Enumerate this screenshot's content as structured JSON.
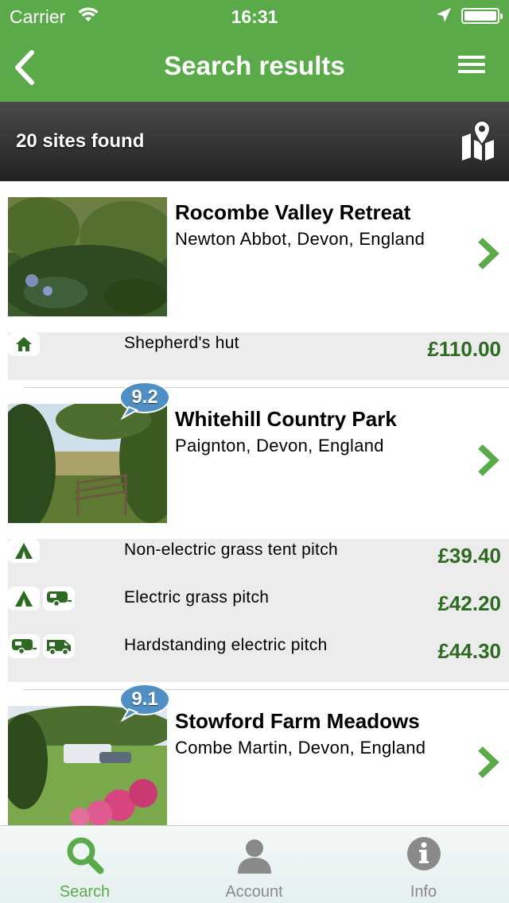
{
  "status_bar": {
    "carrier": "Carrier",
    "time": "16:31"
  },
  "nav": {
    "title": "Search results"
  },
  "results": {
    "count_text": "20 sites found"
  },
  "sites": [
    {
      "name": "Rocombe Valley Retreat",
      "location": "Newton Abbot, Devon, England",
      "rating": null,
      "pitches": [
        {
          "label": "Shepherd's hut",
          "price": "£110.00",
          "icons": [
            "house-icon"
          ]
        }
      ]
    },
    {
      "name": "Whitehill Country Park",
      "location": "Paignton, Devon, England",
      "rating": "9.2",
      "pitches": [
        {
          "label": "Non-electric grass tent pitch",
          "price": "£39.40",
          "icons": [
            "tent-icon"
          ]
        },
        {
          "label": "Electric grass pitch",
          "price": "£42.20",
          "icons": [
            "tent-icon",
            "caravan-icon"
          ]
        },
        {
          "label": "Hardstanding electric pitch",
          "price": "£44.30",
          "icons": [
            "caravan-icon",
            "motorhome-icon"
          ]
        }
      ]
    },
    {
      "name": "Stowford Farm Meadows",
      "location": "Combe Martin, Devon, England",
      "rating": "9.1",
      "pitches": []
    }
  ],
  "tabs": [
    {
      "label": "Search",
      "icon": "search-icon",
      "active": true
    },
    {
      "label": "Account",
      "icon": "account-icon",
      "active": false
    },
    {
      "label": "Info",
      "icon": "info-icon",
      "active": false
    }
  ],
  "colors": {
    "brand_green": "#5aaa4a",
    "price_green": "#2f6a24",
    "rating_blue": "#4f8fc4"
  }
}
